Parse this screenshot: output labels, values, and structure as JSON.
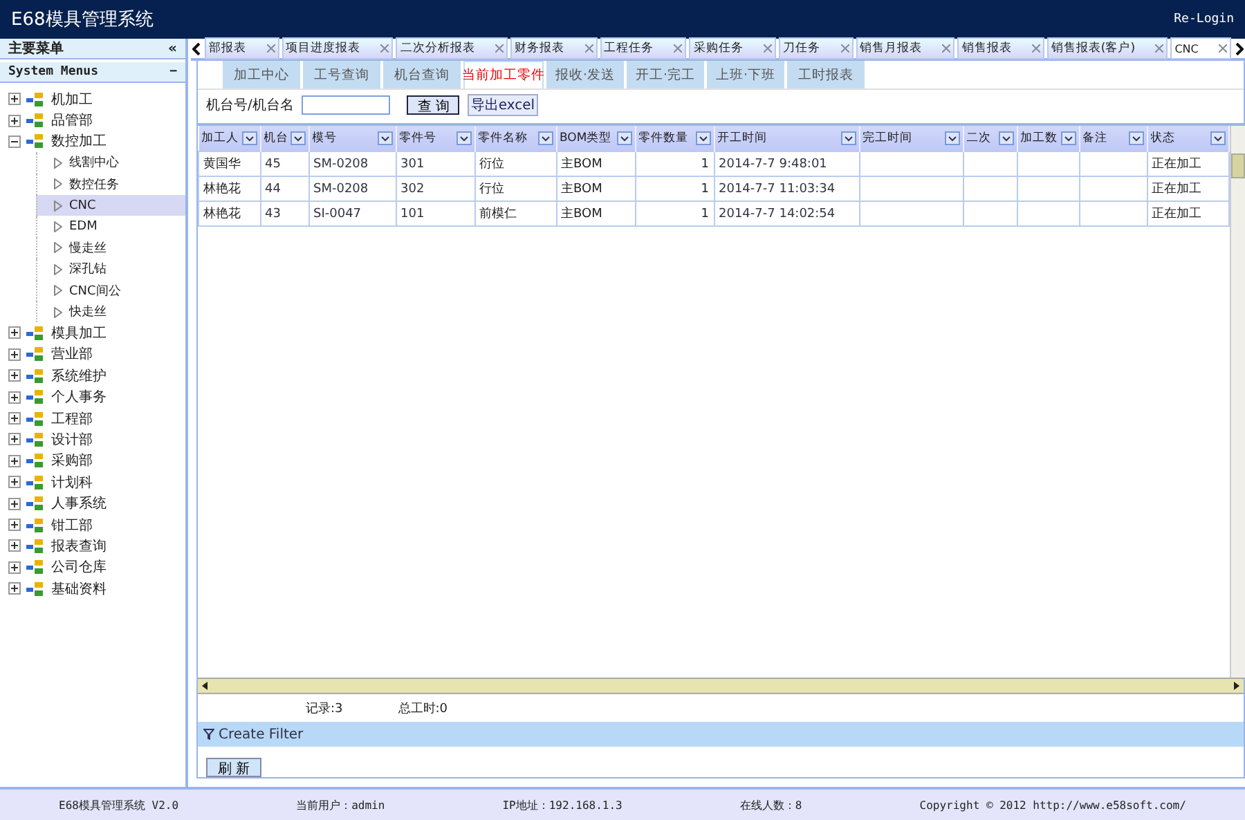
{
  "window": {
    "title": "E68模具管理系统",
    "relogin": "Re-Login"
  },
  "sidebar": {
    "title": "主要菜单",
    "collapse": "«",
    "section": "System Menus",
    "section_toggle": "−",
    "items": [
      {
        "label": "机加工",
        "expanded": false,
        "selected": false
      },
      {
        "label": "品管部",
        "expanded": false,
        "selected": false
      },
      {
        "label": "数控加工",
        "expanded": true,
        "selected": false,
        "children": [
          {
            "label": "线割中心",
            "selected": false
          },
          {
            "label": "数控任务",
            "selected": false
          },
          {
            "label": "CNC",
            "selected": true
          },
          {
            "label": "EDM",
            "selected": false
          },
          {
            "label": "慢走丝",
            "selected": false
          },
          {
            "label": "深孔钻",
            "selected": false
          },
          {
            "label": "CNC间公",
            "selected": false
          },
          {
            "label": "快走丝",
            "selected": false
          }
        ]
      },
      {
        "label": "模具加工",
        "expanded": false,
        "selected": false
      },
      {
        "label": "营业部",
        "expanded": false,
        "selected": false
      },
      {
        "label": "系统维护",
        "expanded": false,
        "selected": false
      },
      {
        "label": "个人事务",
        "expanded": false,
        "selected": false
      },
      {
        "label": "工程部",
        "expanded": false,
        "selected": false
      },
      {
        "label": "设计部",
        "expanded": false,
        "selected": false
      },
      {
        "label": "采购部",
        "expanded": false,
        "selected": false
      },
      {
        "label": "计划科",
        "expanded": false,
        "selected": false
      },
      {
        "label": "人事系统",
        "expanded": false,
        "selected": false
      },
      {
        "label": "钳工部",
        "expanded": false,
        "selected": false
      },
      {
        "label": "报表查询",
        "expanded": false,
        "selected": false
      },
      {
        "label": "公司仓库",
        "expanded": false,
        "selected": false
      },
      {
        "label": "基础资料",
        "expanded": false,
        "selected": false
      }
    ]
  },
  "tabs": [
    {
      "label": "部报表",
      "selected": false
    },
    {
      "label": "项目进度报表",
      "selected": false
    },
    {
      "label": "二次分析报表",
      "selected": false
    },
    {
      "label": "财务报表",
      "selected": false
    },
    {
      "label": "工程任务",
      "selected": false
    },
    {
      "label": "采购任务",
      "selected": false
    },
    {
      "label": "刀任务",
      "selected": false
    },
    {
      "label": "销售月报表",
      "selected": false
    },
    {
      "label": "销售报表",
      "selected": false
    },
    {
      "label": "销售报表(客户)",
      "selected": false
    },
    {
      "label": "CNC",
      "selected": true
    }
  ],
  "subtabs": [
    {
      "label": "加工中心",
      "selected": false
    },
    {
      "label": "工号查询",
      "selected": false
    },
    {
      "label": "机台查询",
      "selected": false
    },
    {
      "label": "当前加工零件",
      "selected": true
    },
    {
      "label": "报收·发送",
      "selected": false
    },
    {
      "label": "开工·完工",
      "selected": false
    },
    {
      "label": "上班·下班",
      "selected": false
    },
    {
      "label": "工时报表",
      "selected": false
    }
  ],
  "search": {
    "label": "机台号/机台名",
    "button": "查 询",
    "export": "导出excel"
  },
  "table": {
    "columns": [
      "加工人",
      "机台",
      "模号",
      "零件号",
      "零件名称",
      "BOM类型",
      "零件数量",
      "开工时间",
      "完工时间",
      "二次",
      "加工数",
      "备注",
      "状态"
    ],
    "rows": [
      [
        "黄国华",
        "45",
        "SM-0208",
        "301",
        "衍位",
        "主BOM",
        "1",
        "2014-7-7 9:48:01",
        "",
        "",
        "",
        "",
        "正在加工"
      ],
      [
        "林艳花",
        "44",
        "SM-0208",
        "302",
        "行位",
        "主BOM",
        "1",
        "2014-7-7 11:03:34",
        "",
        "",
        "",
        "",
        "正在加工"
      ],
      [
        "林艳花",
        "43",
        "SI-0047",
        "101",
        "前模仁",
        "主BOM",
        "1",
        "2014-7-7 14:02:54",
        "",
        "",
        "",
        "",
        "正在加工"
      ]
    ]
  },
  "summary": {
    "records": "记录:3",
    "hours": "总工时:0"
  },
  "filter": "Create Filter",
  "refresh": "刷 新",
  "status_bar": [
    "E68模具管理系统 V2.0",
    "当前用户：admin",
    "IP地址：192.168.1.3",
    "在线人数：8",
    "Copyright © 2012 http://www.e58soft.com/"
  ]
}
